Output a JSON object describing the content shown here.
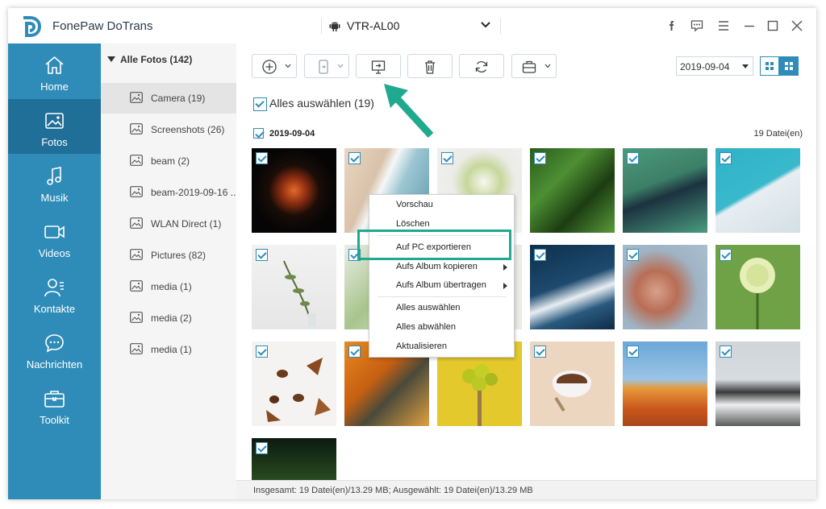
{
  "titlebar": {
    "app_title": "FonePaw DoTrans",
    "device_name": "VTR-AL00"
  },
  "sidebar": {
    "items": [
      {
        "label": "Home",
        "icon": "home-icon"
      },
      {
        "label": "Fotos",
        "icon": "photo-icon",
        "active": true
      },
      {
        "label": "Musik",
        "icon": "music-icon"
      },
      {
        "label": "Videos",
        "icon": "video-icon"
      },
      {
        "label": "Kontakte",
        "icon": "contacts-icon"
      },
      {
        "label": "Nachrichten",
        "icon": "messages-icon"
      },
      {
        "label": "Toolkit",
        "icon": "toolkit-icon"
      }
    ]
  },
  "albums": {
    "header": "Alle Fotos (142)",
    "items": [
      {
        "label": "Camera (19)",
        "selected": true
      },
      {
        "label": "Screenshots (26)"
      },
      {
        "label": "beam (2)"
      },
      {
        "label": "beam-2019-09-16 ..."
      },
      {
        "label": "WLAN Direct (1)"
      },
      {
        "label": "Pictures (82)"
      },
      {
        "label": "media (1)"
      },
      {
        "label": "media (2)"
      },
      {
        "label": "media (1)"
      }
    ]
  },
  "toolbar": {
    "buttons": [
      "add-icon",
      "device-transfer-icon",
      "export-to-pc-icon",
      "delete-icon",
      "refresh-icon",
      "toolbox-icon"
    ],
    "date_filter": "2019-09-04"
  },
  "main": {
    "select_all": "Alles auswählen (19)",
    "group_date": "2019-09-04",
    "group_count": "19 Datei(en)"
  },
  "context_menu": {
    "items": [
      "Vorschau",
      "Löschen",
      "Auf PC exportieren",
      "Aufs Album kopieren",
      "Aufs Album übertragen",
      "Alles auswählen",
      "Alles abwählen",
      "Aktualisieren"
    ]
  },
  "status": "Insgesamt: 19 Datei(en)/13.29 MB; Ausgewählt: 19 Datei(en)/13.29 MB",
  "colors": {
    "sidebar": "#2f8cb8",
    "sidebar_active": "#1f6f98",
    "highlight": "#1fa98f"
  }
}
